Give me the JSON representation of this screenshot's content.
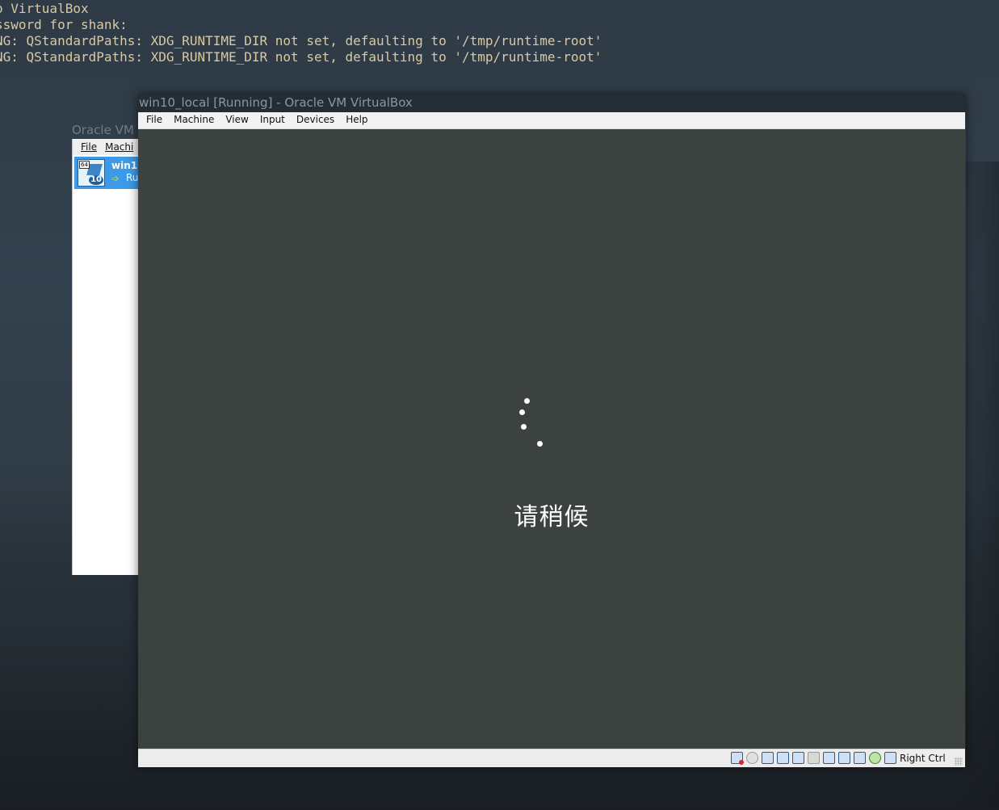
{
  "terminal": {
    "lines": [
      "o VirtualBox",
      "ssword for shank:",
      "NG: QStandardPaths: XDG_RUNTIME_DIR not set, defaulting to '/tmp/runtime-root'",
      "NG: QStandardPaths: XDG_RUNTIME_DIR not set, defaulting to '/tmp/runtime-root'"
    ]
  },
  "manager": {
    "title": "Oracle VM",
    "menu": [
      "File",
      "Machi"
    ],
    "vm": {
      "name": "win1",
      "state": "Ru",
      "os_badge_bits": "64",
      "os_badge_version": "10",
      "os_icon": "windows-10-icon",
      "state_icon": "running-arrow-icon"
    }
  },
  "vm_window": {
    "title": "win10_local [Running] - Oracle VM VirtualBox",
    "menu": [
      "File",
      "Machine",
      "View",
      "Input",
      "Devices",
      "Help"
    ],
    "screen": {
      "background": "#3b423f",
      "wait_text": "请稍候",
      "spinner_icon": "loading-dots-icon"
    },
    "statusbar": {
      "icons": [
        "hard-disk-icon",
        "optical-drive-icon",
        "audio-icon",
        "network-icon",
        "usb-icon",
        "shared-folders-icon",
        "display-icon",
        "video-capture-icon",
        "virtualization-icon",
        "mouse-integration-icon",
        "keyboard-capture-icon"
      ],
      "host_key": "Right Ctrl"
    }
  },
  "colors": {
    "terminal_text": "#d9c9a3",
    "titlebar_bg": "#252d34",
    "selection_blue": "#3d9ae8"
  }
}
